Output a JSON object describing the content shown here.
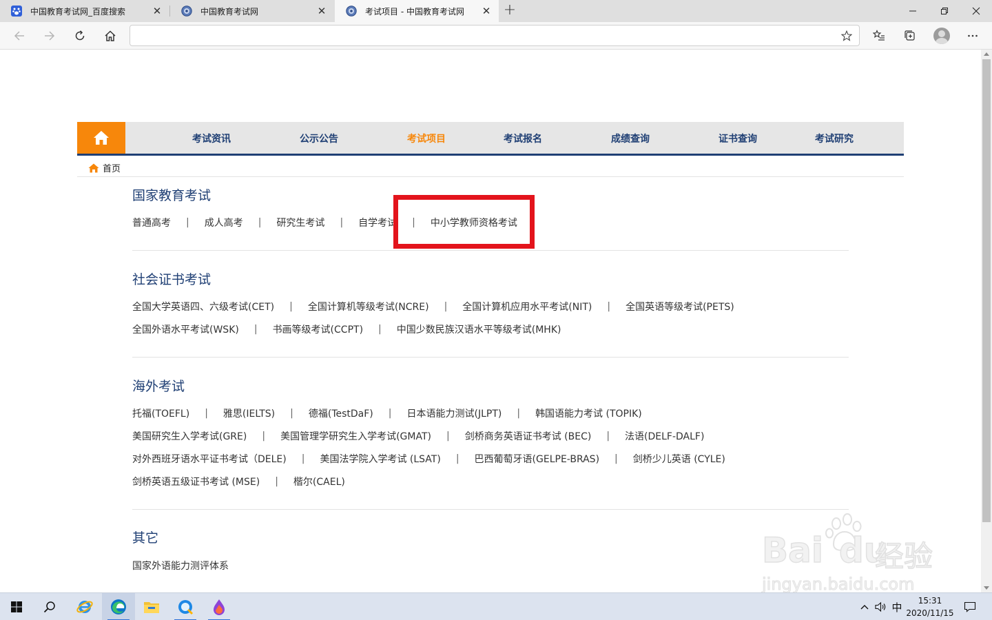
{
  "browser": {
    "tabs": [
      {
        "title": "中国教育考试网_百度搜索",
        "favicon": "baidu-paw-icon",
        "active": false
      },
      {
        "title": "中国教育考试网",
        "favicon": "neea-logo-icon",
        "active": false
      },
      {
        "title": "考试项目 - 中国教育考试网",
        "favicon": "neea-logo-icon",
        "active": true
      }
    ],
    "address": {
      "value": "",
      "placeholder": ""
    }
  },
  "page": {
    "nav": {
      "items": [
        {
          "label": "考试资讯",
          "active": false
        },
        {
          "label": "公示公告",
          "active": false
        },
        {
          "label": "考试项目",
          "active": true
        },
        {
          "label": "考试报名",
          "active": false
        },
        {
          "label": "成绩查询",
          "active": false
        },
        {
          "label": "证书查询",
          "active": false
        },
        {
          "label": "考试研究",
          "active": false
        }
      ]
    },
    "breadcrumb": {
      "home": "首页"
    },
    "sections": [
      {
        "title": "国家教育考试",
        "rows": [
          [
            "普通高考",
            "成人高考",
            "研究生考试",
            "自学考试",
            "中小学教师资格考试"
          ]
        ]
      },
      {
        "title": "社会证书考试",
        "rows": [
          [
            "全国大学英语四、六级考试(CET)",
            "全国计算机等级考试(NCRE)",
            "全国计算机应用水平考试(NIT)",
            "全国英语等级考试(PETS)"
          ],
          [
            "全国外语水平考试(WSK)",
            "书画等级考试(CCPT)",
            "中国少数民族汉语水平等级考试(MHK)"
          ]
        ]
      },
      {
        "title": "海外考试",
        "rows": [
          [
            "托福(TOEFL)",
            "雅思(IELTS)",
            "德福(TestDaF)",
            "日本语能力测试(JLPT)",
            "韩国语能力考试 (TOPIK)"
          ],
          [
            "美国研究生入学考试(GRE)",
            "美国管理学研究生入学考试(GMAT)",
            "剑桥商务英语证书考试 (BEC)",
            "法语(DELF-DALF)"
          ],
          [
            "对外西班牙语水平证书考试（DELE)",
            "美国法学院入学考试 (LSAT)",
            "巴西葡萄牙语(GELPE-BRAS)",
            "剑桥少儿英语 (CYLE)"
          ],
          [
            "剑桥英语五级证书考试 (MSE)",
            "楷尔(CAEL)"
          ]
        ]
      },
      {
        "title": "其它",
        "rows": [
          [
            "国家外语能力测评体系"
          ]
        ]
      }
    ],
    "separator": "|",
    "highlight_color": "#e3141c",
    "accent_color": "#f7870b",
    "nav_text_color": "#1f3f74"
  },
  "watermark": {
    "brand": "Bai",
    "brand_tail": "du",
    "brand_cn": "经验",
    "url": "jingyan.baidu.com"
  },
  "taskbar": {
    "apps": [
      "start-icon",
      "search-icon",
      "ie-icon",
      "edge-icon",
      "file-explorer-icon",
      "browser-app-icon",
      "paint-drop-icon"
    ],
    "ime": "中",
    "time": "15:31",
    "date": "2020/11/15"
  }
}
